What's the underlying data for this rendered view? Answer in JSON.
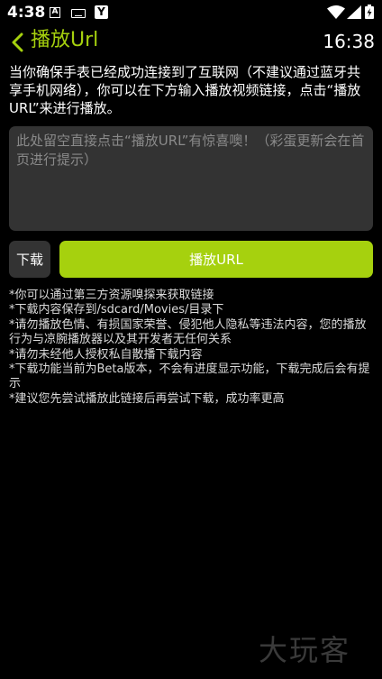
{
  "status_bar": {
    "time": "4:38",
    "icons": [
      "text-a-icon",
      "keyboard-icon",
      "y-app-icon",
      "wifi-icon",
      "cell-signal-icon",
      "battery-charging-icon"
    ]
  },
  "header": {
    "back_icon": "chevron-left-icon",
    "title": "播放Url",
    "clock": "16:38"
  },
  "intro": {
    "text": "当你确保手表已经成功连接到了互联网（不建议通过蓝牙共享手机网络），你可以在下方输入播放视频链接，点击“播放URL”来进行播放。"
  },
  "url_input": {
    "value": "",
    "placeholder": "此处留空直接点击“播放URL”有惊喜噢！（彩蛋更新会在首页进行提示）"
  },
  "actions": {
    "download_label": "下载",
    "play_label": "播放URL"
  },
  "notes": [
    "*你可以通过第三方资源嗅探来获取链接",
    "*下载内容保存到/sdcard/Movies/目录下",
    "*请勿播放色情、有损国家荣誉、侵犯他人隐私等违法内容，您的播放行为与凉腕播放器以及其开发者无任何关系",
    "*请勿未经他人授权私自散播下载内容",
    "*下载功能当前为Beta版本，不会有进度显示功能，下载完成后会有提示",
    "*建议您先尝试播放此链接后再尝试下载，成功率更高"
  ],
  "watermark": "大玩客",
  "colors": {
    "accent": "#a6d10e",
    "background": "#000000",
    "surface": "#333333",
    "text": "#ffffff"
  }
}
